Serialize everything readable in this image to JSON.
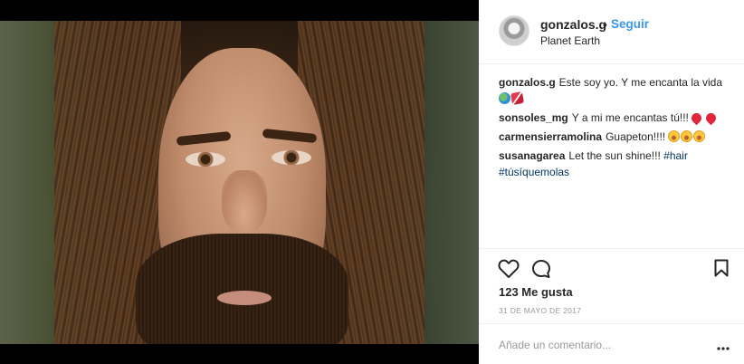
{
  "post": {
    "author": {
      "username": "gonzalos.g",
      "follow_label": "Seguir",
      "separator": "•",
      "location": "Planet Earth"
    },
    "caption": {
      "user": "gonzalos.g",
      "text": "Este soy yo. Y me encanta la vida",
      "emojis": [
        "globe",
        "broken-heart"
      ]
    },
    "comments": [
      {
        "user": "sonsoles_mg",
        "text": "Y a mi me encantas tú!!!",
        "emojis": [
          "heart",
          "heart"
        ]
      },
      {
        "user": "carmensierramolina",
        "text": "Guapeton!!!!",
        "emojis": [
          "blush",
          "blush",
          "blush"
        ]
      },
      {
        "user": "susanagarea",
        "text": "Let the sun shine!!!",
        "tags": [
          "#hair",
          "#túsíquemolas"
        ]
      }
    ],
    "likes_label": "123 Me gusta",
    "date": "31 de mayo de 2017",
    "add_comment_placeholder": "Añade un comentario...",
    "icons": {
      "like": "heart-icon",
      "comment": "comment-icon",
      "save": "bookmark-icon",
      "more": "more-icon"
    },
    "colors": {
      "link": "#3897f0",
      "hashtag": "#003569",
      "muted": "#999999",
      "text": "#262626"
    }
  }
}
